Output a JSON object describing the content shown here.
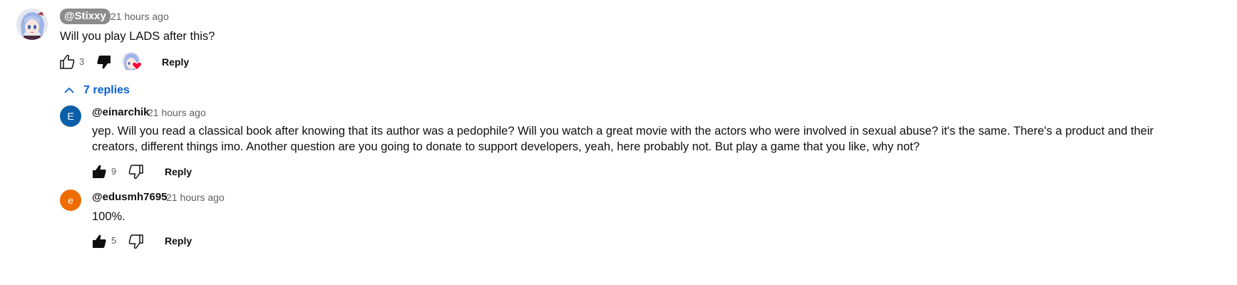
{
  "top_comment": {
    "handle": "@Stixxy",
    "time": "21 hours ago",
    "text": "Will you play LADS after this?",
    "likes": "3",
    "reply_label": "Reply",
    "replies_toggle": "7 replies",
    "accent": "#065fd4"
  },
  "replies": [
    {
      "avatar_letter": "E",
      "avatar_color": "#0b5fa8",
      "handle": "@einarchik",
      "time": "21 hours ago",
      "text_line1": "yep. Will you read a classical book after knowing that its author was a pedophile? Will you watch a great movie with the actors who were involved in sexual abuse? it's the same. There's a product and their",
      "text_line2": "creators, different things imo. Another question are you going to donate to support developers, yeah, here probably not. But play a game that you like, why not?",
      "likes": "9",
      "reply_label": "Reply"
    },
    {
      "avatar_letter": "e",
      "avatar_color": "#ef6c00",
      "handle": "@edusmh7695",
      "time": "21 hours ago",
      "text_line1": "100%.",
      "likes": "5",
      "reply_label": "Reply"
    }
  ]
}
